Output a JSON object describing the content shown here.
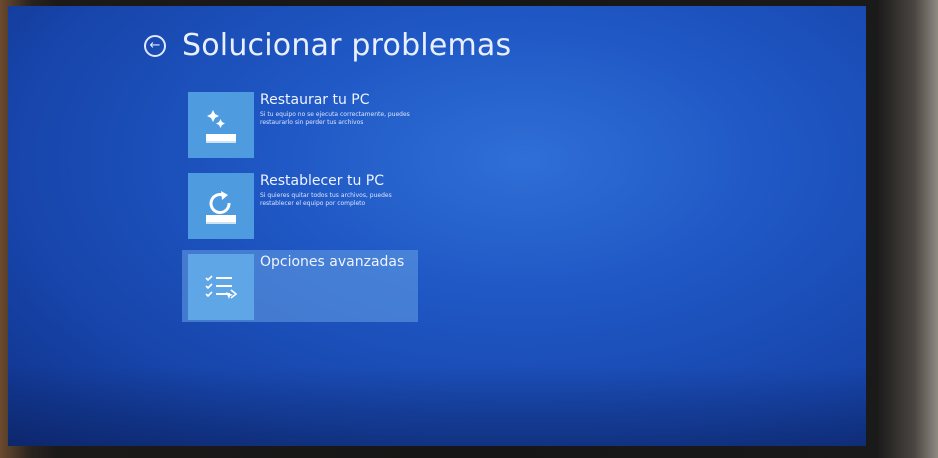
{
  "header": {
    "title": "Solucionar problemas",
    "back_icon": "back-arrow-icon"
  },
  "options": [
    {
      "title": "Restaurar tu PC",
      "description": "Si tu equipo no se ejecuta correctamente, puedes restaurarlo sin perder tus archivos",
      "icon": "restore-sparkle-icon"
    },
    {
      "title": "Restablecer tu PC",
      "description": "Si quieres quitar todos tus archivos, puedes restablecer el equipo por completo",
      "icon": "reset-refresh-icon"
    },
    {
      "title": "Opciones avanzadas",
      "description": "",
      "icon": "checklist-icon"
    }
  ],
  "colors": {
    "background": "#1f57c4",
    "tile": "#4f9bdf",
    "text": "#eef3ff"
  }
}
